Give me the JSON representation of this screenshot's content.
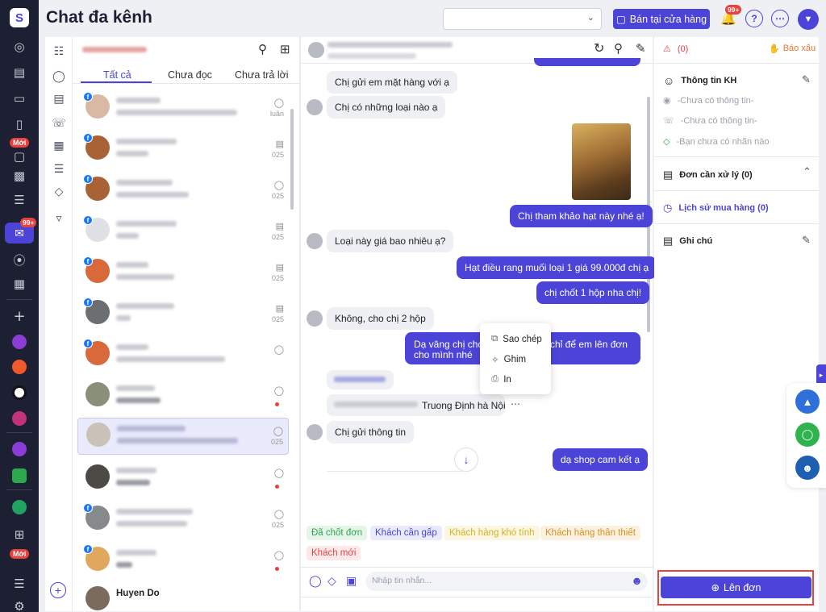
{
  "app": {
    "title": "Chat đa kênh",
    "rail_badge_count": "99+",
    "rail_new_label_1": "Mới",
    "rail_new_label_2": "Mới"
  },
  "header": {
    "store_button": "Bán tại cửa hàng",
    "notif_count": "99+",
    "help_icon": "?",
    "more_icon": "⋯"
  },
  "conversation_list": {
    "tabs": [
      "Tất cả",
      "Chưa đọc",
      "Chưa trả lời"
    ],
    "meta_days": [
      "luần",
      "025",
      "025",
      "025",
      "025",
      "025",
      "025",
      "025"
    ],
    "last_name": "Huyen Do"
  },
  "chat": {
    "messages": [
      {
        "text": "Chị gửi em mặt hàng với ạ",
        "dir": "in"
      },
      {
        "text": "Chị có những loại nào ạ",
        "dir": "in"
      },
      {
        "text": "Chị tham khảo hạt này nhé ạ!",
        "dir": "out"
      },
      {
        "text": "Loại này giá bao nhiêu ạ?",
        "dir": "in"
      },
      {
        "text": "Hạt điều rang muối loại 1 giá 99.000đ chị ạ",
        "dir": "out"
      },
      {
        "text": "chị chốt 1 hộp nha chị!",
        "dir": "out"
      },
      {
        "text": "Không, cho chị 2 hộp",
        "dir": "in"
      },
      {
        "text": "Dạ vâng chị cho",
        "dir": "out"
      },
      {
        "text": "chỉ để em lên đơn",
        "dir": "out"
      },
      {
        "text": "cho mình nhé",
        "dir": "out"
      },
      {
        "text": "Truong Định hà Nội",
        "dir": "in"
      },
      {
        "text": "Chị gửi thông tin",
        "dir": "in"
      },
      {
        "text": "dạ shop cam kết ạ",
        "dir": "out"
      }
    ],
    "context_menu": [
      "Sao chép",
      "Ghim",
      "In"
    ],
    "tags": [
      "Đã chốt đơn",
      "Khách cần gấp",
      "Khách hàng khó tính",
      "Khách hàng thân thiết",
      "Khách mới"
    ],
    "input_placeholder": "Nhập tin nhắn..."
  },
  "info_panel": {
    "warning_count": "(0)",
    "report_label": "Báo xấu",
    "customer_info_label": "Thông tin KH",
    "no_info_1": "-Chưa có thông tin-",
    "no_info_2": "-Chưa có thông tin-",
    "no_label": "-Bạn chưa có nhãn nào",
    "pending_orders": "Đơn cần xử lý (0)",
    "purchase_history": "Lịch sử mua hàng (0)",
    "notes": "Ghi chú",
    "create_order": "Lên đơn"
  },
  "colors": {
    "accent": "#4c44d8",
    "rail": "#1d2033",
    "danger": "#e8423f"
  }
}
